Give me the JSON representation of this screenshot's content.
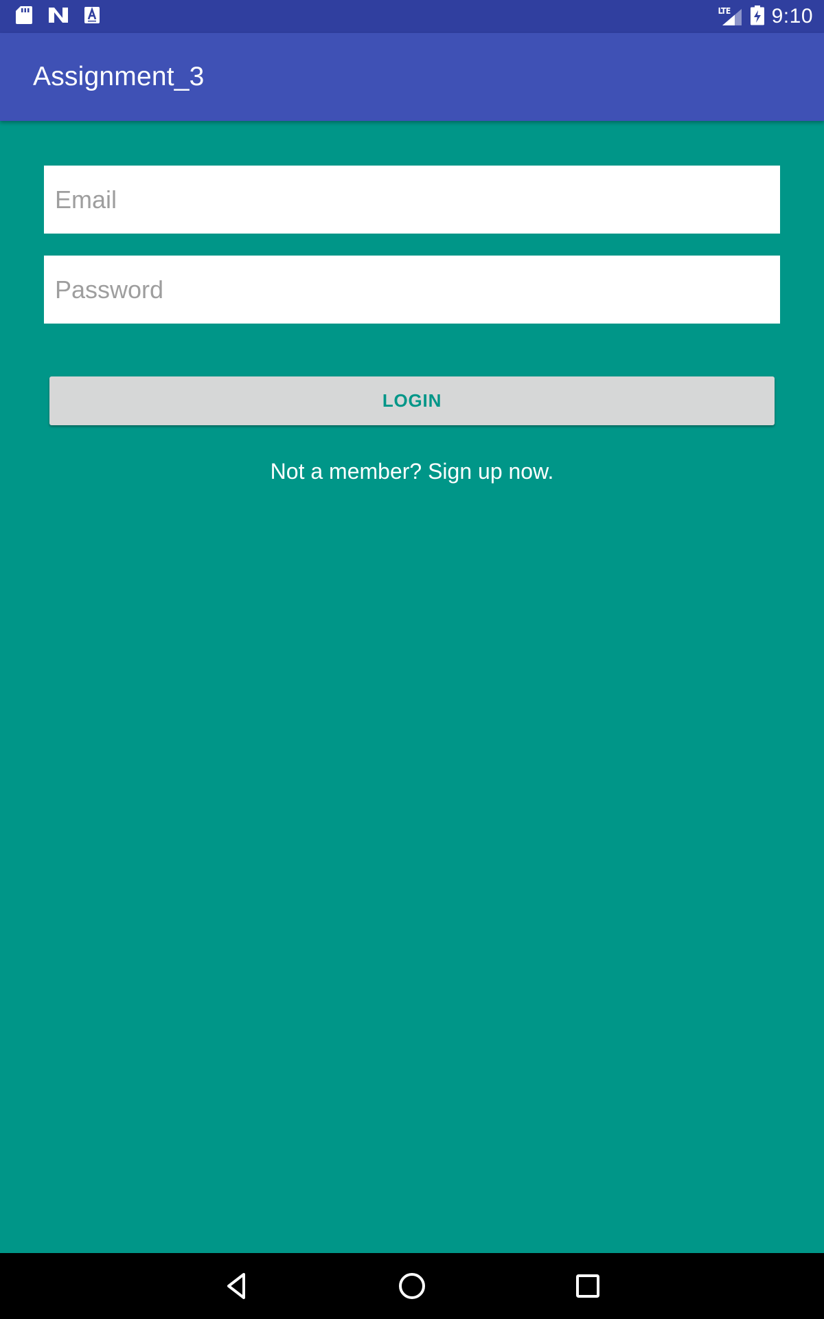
{
  "status_bar": {
    "time": "9:10",
    "network_label": "LTE",
    "icons": [
      "sd-card-icon",
      "n-logo-icon",
      "a-badge-icon",
      "lte-signal-icon",
      "battery-charging-icon"
    ]
  },
  "app_bar": {
    "title": "Assignment_3"
  },
  "form": {
    "email_placeholder": "Email",
    "password_placeholder": "Password",
    "login_label": "LOGIN",
    "signup_text": "Not a member? Sign up now."
  },
  "nav_bar": {
    "icons": [
      "back-icon",
      "home-icon",
      "recents-icon"
    ]
  },
  "colors": {
    "status_bar": "#303F9F",
    "app_bar": "#3F51B5",
    "background": "#009688",
    "button": "#D6D7D7",
    "button_text": "#009688"
  }
}
